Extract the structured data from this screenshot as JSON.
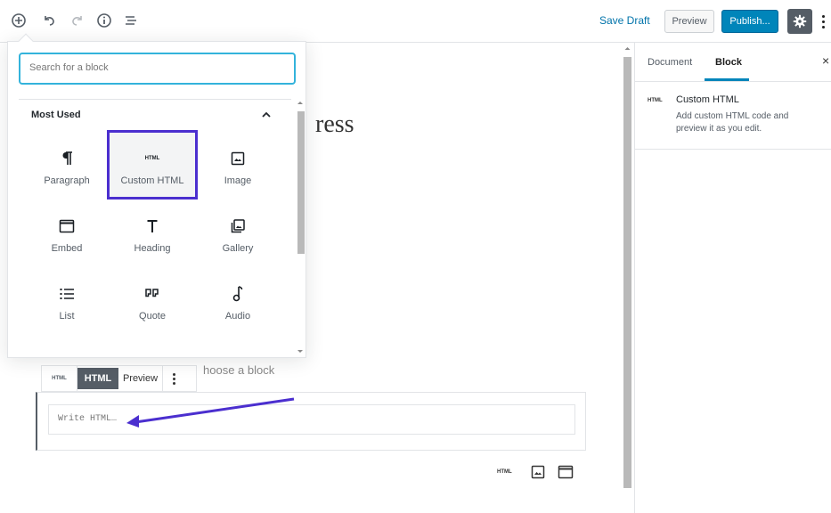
{
  "toolbar": {
    "icons": [
      "add-block-icon",
      "undo-icon",
      "redo-icon",
      "info-icon",
      "outline-icon"
    ],
    "save_draft": "Save Draft",
    "preview": "Preview",
    "publish": "Publish...",
    "publish_color": "#0085ba"
  },
  "editor": {
    "title_fragment": "ress",
    "choose_block_fragment": "hoose a block",
    "html_block": {
      "icon_label": "HTML",
      "tab_html": "HTML",
      "tab_preview": "Preview",
      "placeholder": "Write HTML…"
    },
    "bottom_icons": [
      "html-icon",
      "image-icon",
      "embed-icon"
    ],
    "bottom_icon_html_label": "HTML"
  },
  "inserter": {
    "search_placeholder": "Search for a block",
    "section_title": "Most Used",
    "blocks": [
      {
        "label": "Paragraph",
        "icon": "paragraph-icon"
      },
      {
        "label": "Custom HTML",
        "icon": "html-icon",
        "icon_text": "HTML",
        "highlighted": true
      },
      {
        "label": "Image",
        "icon": "image-icon"
      },
      {
        "label": "Embed",
        "icon": "embed-icon"
      },
      {
        "label": "Heading",
        "icon": "heading-icon"
      },
      {
        "label": "Gallery",
        "icon": "gallery-icon"
      },
      {
        "label": "List",
        "icon": "list-icon"
      },
      {
        "label": "Quote",
        "icon": "quote-icon"
      },
      {
        "label": "Audio",
        "icon": "audio-icon"
      }
    ],
    "highlight_color": "#4b2fcf"
  },
  "sidebar": {
    "tab_document": "Document",
    "tab_block": "Block",
    "close": "×",
    "block_card": {
      "icon_text": "HTML",
      "title": "Custom HTML",
      "description": "Add custom HTML code and preview it as you edit."
    }
  }
}
